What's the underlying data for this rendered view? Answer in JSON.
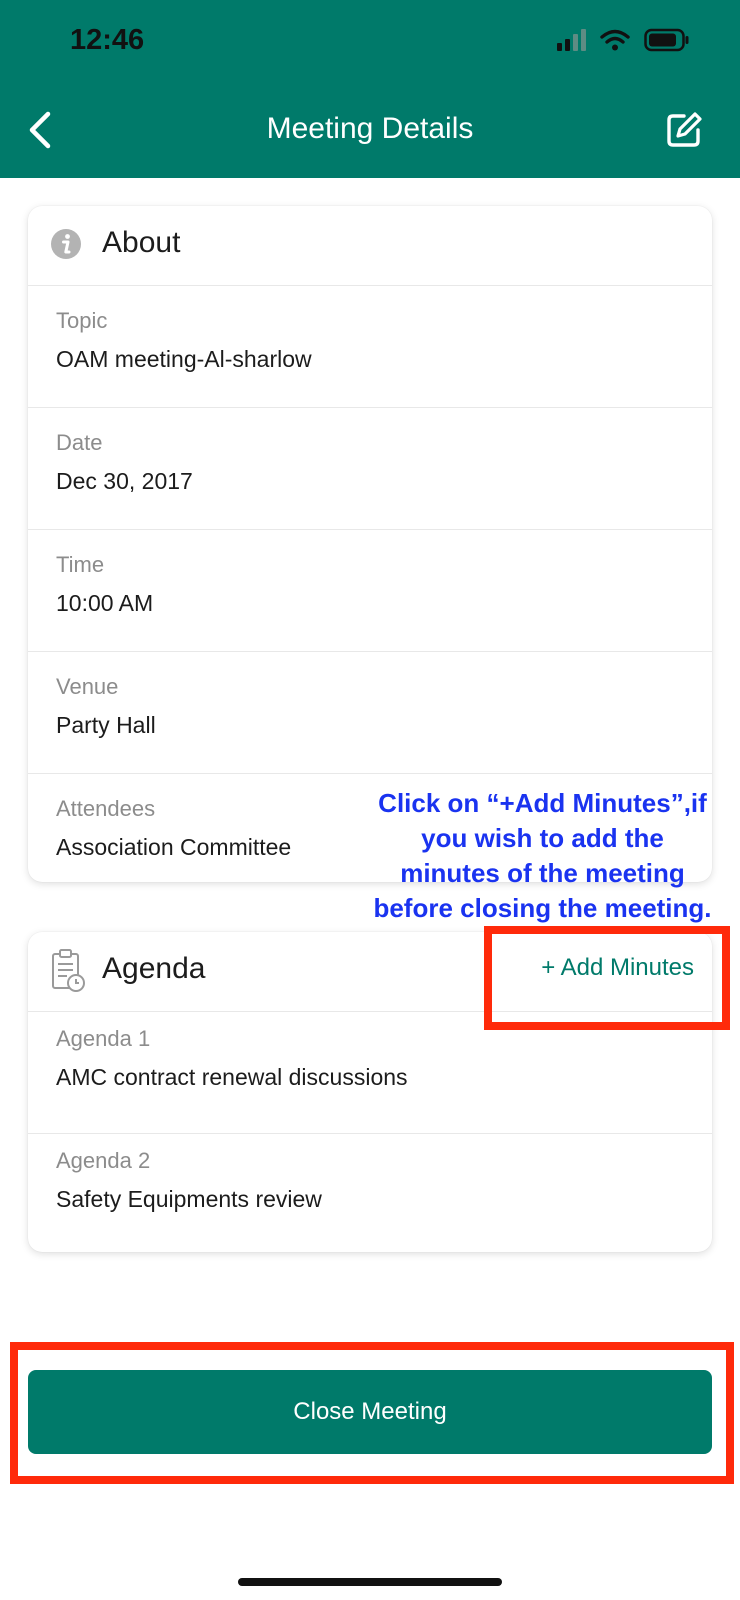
{
  "status_bar": {
    "time": "12:46"
  },
  "header": {
    "title": "Meeting Details"
  },
  "about": {
    "title": "About",
    "fields": [
      {
        "label": "Topic",
        "value": "OAM meeting-Al-sharlow"
      },
      {
        "label": "Date",
        "value": "Dec 30, 2017"
      },
      {
        "label": "Time",
        "value": "10:00 AM"
      },
      {
        "label": "Venue",
        "value": "Party Hall"
      },
      {
        "label": "Attendees",
        "value": "Association Committee"
      }
    ]
  },
  "agenda": {
    "title": "Agenda",
    "add_minutes_label": "+ Add Minutes",
    "items": [
      {
        "label": "Agenda 1",
        "value": "AMC contract renewal discussions"
      },
      {
        "label": "Agenda 2",
        "value": "Safety Equipments review"
      }
    ]
  },
  "annotation": {
    "lines": [
      "Click on “+Add Minutes”,if",
      "you wish to add the",
      "minutes of the meeting",
      "before closing the meeting."
    ]
  },
  "close_button": {
    "label": "Close Meeting"
  },
  "colors": {
    "primary": "#007a6a",
    "annotation_text": "#1a33f0",
    "highlight_border": "#ff2a0a"
  }
}
